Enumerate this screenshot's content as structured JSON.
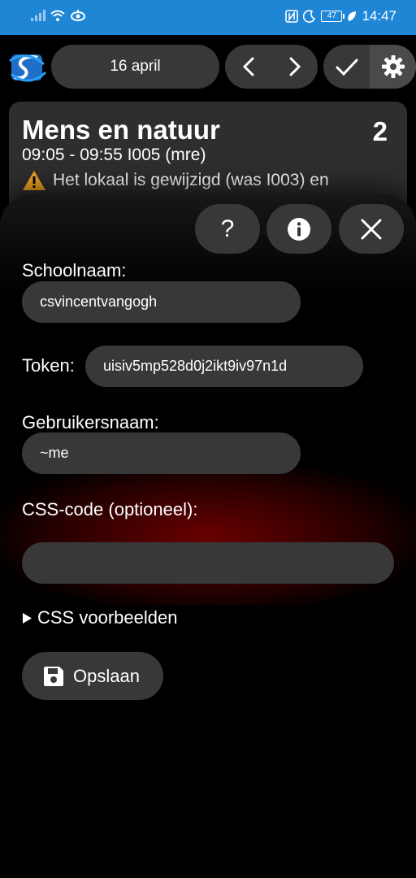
{
  "status_bar": {
    "battery": "47",
    "time": "14:47"
  },
  "header": {
    "date": "16 april"
  },
  "lesson": {
    "title": "Mens en natuur",
    "hour": "2",
    "time_room": "09:05 - 09:55   I005 (mre)",
    "warning": "Het lokaal is gewijzigd (was I003) en"
  },
  "settings": {
    "help_label": "?",
    "school_label": "Schoolnaam:",
    "school_value": "csvincentvangogh",
    "token_label": "Token:",
    "token_value": "uisiv5mp528d0j2ikt9iv97n1d",
    "username_label": "Gebruikersnaam:",
    "username_value": "~me",
    "css_label": "CSS-code (optioneel):",
    "css_value": "",
    "css_examples_label": "CSS voorbeelden",
    "save_label": "Opslaan"
  },
  "colors": {
    "status_bar": "#1f86d6",
    "pill": "#383838",
    "background": "#000000",
    "warning": "#f5a623"
  }
}
